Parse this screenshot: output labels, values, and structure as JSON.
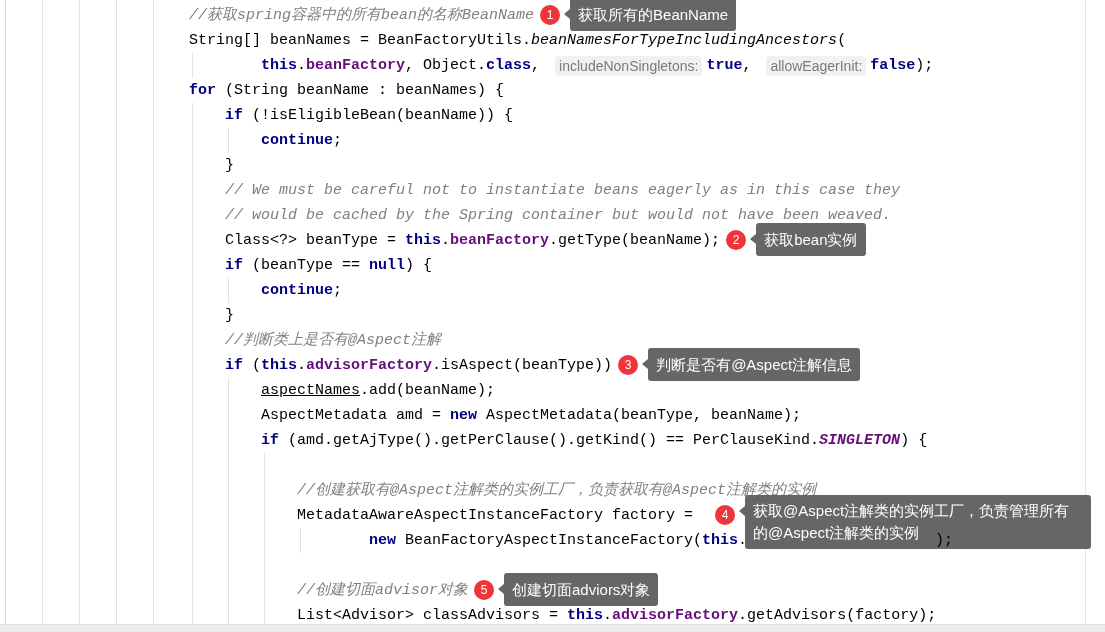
{
  "code_lines": [
    {
      "kind": "line",
      "tokens": [
        {
          "kind": "comment",
          "text": "//获取spring容器中的所有bean的名称BeanName"
        }
      ],
      "callout": {
        "number": "1",
        "text": "获取所有的BeanName"
      }
    },
    {
      "kind": "line",
      "tokens": [
        {
          "kind": "plain",
          "text": "String[] beanNames = BeanFactoryUtils."
        },
        {
          "kind": "static-method",
          "text": "beanNamesForTypeIncludingAncestors"
        },
        {
          "kind": "plain",
          "text": "("
        }
      ],
      "children": [
        {
          "kind": "continuation",
          "tokens": [
            {
              "kind": "keyword",
              "text": "this"
            },
            {
              "kind": "plain",
              "text": "."
            },
            {
              "kind": "field",
              "text": "beanFactory"
            },
            {
              "kind": "plain",
              "text": ", Object."
            },
            {
              "kind": "keyword",
              "text": "class"
            },
            {
              "kind": "plain",
              "text": ", "
            },
            {
              "kind": "hint",
              "text": "includeNonSingletons:"
            },
            {
              "kind": "keyword",
              "text": "true"
            },
            {
              "kind": "plain",
              "text": ", "
            },
            {
              "kind": "hint",
              "text": "allowEagerInit:"
            },
            {
              "kind": "keyword",
              "text": "false"
            },
            {
              "kind": "plain",
              "text": ");"
            }
          ]
        }
      ]
    },
    {
      "kind": "line",
      "tokens": [
        {
          "kind": "keyword",
          "text": "for"
        },
        {
          "kind": "plain",
          "text": " (String beanName : beanNames) {"
        }
      ],
      "children": [
        {
          "kind": "line",
          "tokens": [
            {
              "kind": "keyword",
              "text": "if"
            },
            {
              "kind": "plain",
              "text": " (!isEligibleBean(beanName)) {"
            }
          ],
          "children": [
            {
              "kind": "line",
              "tokens": [
                {
                  "kind": "keyword",
                  "text": "continue"
                },
                {
                  "kind": "plain",
                  "text": ";"
                }
              ]
            }
          ]
        },
        {
          "kind": "line",
          "tokens": [
            {
              "kind": "plain",
              "text": "}"
            }
          ]
        },
        {
          "kind": "line",
          "tokens": [
            {
              "kind": "comment",
              "text": "// We must be careful not to instantiate beans eagerly as in this case they"
            }
          ]
        },
        {
          "kind": "line",
          "tokens": [
            {
              "kind": "comment",
              "text": "// would be cached by the Spring container but would not have been weaved."
            }
          ]
        },
        {
          "kind": "line",
          "tokens": [
            {
              "kind": "plain",
              "text": "Class<?> beanType = "
            },
            {
              "kind": "keyword",
              "text": "this"
            },
            {
              "kind": "plain",
              "text": "."
            },
            {
              "kind": "field",
              "text": "beanFactory"
            },
            {
              "kind": "plain",
              "text": ".getType(beanName);"
            }
          ],
          "callout": {
            "number": "2",
            "text": "获取bean实例"
          }
        },
        {
          "kind": "line",
          "tokens": [
            {
              "kind": "keyword",
              "text": "if"
            },
            {
              "kind": "plain",
              "text": " (beanType == "
            },
            {
              "kind": "keyword",
              "text": "null"
            },
            {
              "kind": "plain",
              "text": ") {"
            }
          ],
          "children": [
            {
              "kind": "line",
              "tokens": [
                {
                  "kind": "keyword",
                  "text": "continue"
                },
                {
                  "kind": "plain",
                  "text": ";"
                }
              ]
            }
          ]
        },
        {
          "kind": "line",
          "tokens": [
            {
              "kind": "plain",
              "text": "}"
            }
          ]
        },
        {
          "kind": "line",
          "tokens": [
            {
              "kind": "comment",
              "text": "//判断类上是否有@Aspect注解"
            }
          ]
        },
        {
          "kind": "line",
          "tokens": [
            {
              "kind": "keyword",
              "text": "if"
            },
            {
              "kind": "plain",
              "text": " ("
            },
            {
              "kind": "keyword",
              "text": "this"
            },
            {
              "kind": "plain",
              "text": "."
            },
            {
              "kind": "field",
              "text": "advisorFactory"
            },
            {
              "kind": "plain",
              "text": ".isAspect(beanType))"
            }
          ],
          "callout": {
            "number": "3",
            "text": "判断是否有@Aspect注解信息"
          },
          "children": [
            {
              "kind": "line",
              "tokens": [
                {
                  "kind": "underlined",
                  "text": "aspectNames"
                },
                {
                  "kind": "plain",
                  "text": ".add(beanName);"
                }
              ]
            },
            {
              "kind": "line",
              "tokens": [
                {
                  "kind": "plain",
                  "text": "AspectMetadata amd = "
                },
                {
                  "kind": "keyword",
                  "text": "new"
                },
                {
                  "kind": "plain",
                  "text": " AspectMetadata(beanType, beanName);"
                }
              ]
            },
            {
              "kind": "line",
              "tokens": [
                {
                  "kind": "keyword",
                  "text": "if"
                },
                {
                  "kind": "plain",
                  "text": " (amd.getAjType().getPerClause().getKind() == PerClauseKind."
                },
                {
                  "kind": "constant",
                  "text": "SINGLETON"
                },
                {
                  "kind": "plain",
                  "text": ") {"
                }
              ],
              "children": [
                {
                  "kind": "blank"
                },
                {
                  "kind": "line",
                  "tokens": [
                    {
                      "kind": "comment",
                      "text": "//创建获取有@Aspect注解类的实例工厂，负责获取有@Aspect注解类的实例"
                    }
                  ]
                },
                {
                  "kind": "line",
                  "tokens": [
                    {
                      "kind": "plain",
                      "text": "MetadataAwareAspectInstanceFactory factory ="
                    }
                  ],
                  "callout": {
                    "number": "4",
                    "text": "获取@Aspect注解类的实例工厂，负责管理所有的@Aspect注解类的实例"
                  },
                  "children": [
                    {
                      "kind": "continuation",
                      "tokens": [
                        {
                          "kind": "keyword",
                          "text": "new"
                        },
                        {
                          "kind": "plain",
                          "text": " BeanFactoryAspectInstanceFactory("
                        },
                        {
                          "kind": "keyword",
                          "text": "this"
                        },
                        {
                          "kind": "plain",
                          "text": "."
                        },
                        {
                          "kind": "obscured"
                        },
                        {
                          "kind": "plain",
                          "text": ");"
                        }
                      ]
                    }
                  ]
                },
                {
                  "kind": "blank"
                },
                {
                  "kind": "line",
                  "tokens": [
                    {
                      "kind": "comment",
                      "text": "//创建切面advisor对象"
                    }
                  ],
                  "callout": {
                    "number": "5",
                    "text": "创建切面adviors对象"
                  }
                },
                {
                  "kind": "line",
                  "tokens": [
                    {
                      "kind": "plain",
                      "text": "List<Advisor> classAdvisors = "
                    },
                    {
                      "kind": "keyword",
                      "text": "this"
                    },
                    {
                      "kind": "plain",
                      "text": "."
                    },
                    {
                      "kind": "field",
                      "text": "advisorFactory"
                    },
                    {
                      "kind": "plain",
                      "text": ".getAdvisors(factory);"
                    }
                  ]
                }
              ]
            }
          ]
        }
      ]
    }
  ]
}
